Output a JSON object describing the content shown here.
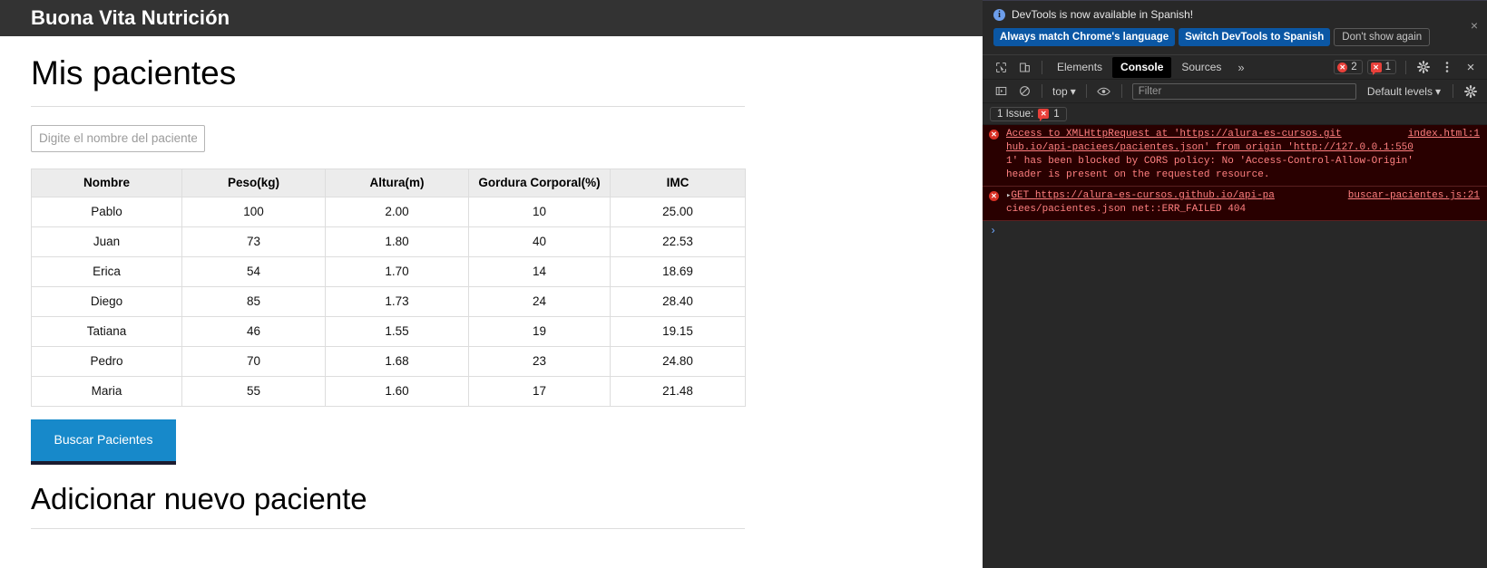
{
  "page": {
    "app_title": "Buona Vita Nutrición",
    "heading_patients": "Mis pacientes",
    "search": {
      "placeholder": "Digite el nombre del paciente",
      "value": ""
    },
    "table": {
      "headers": [
        "Nombre",
        "Peso(kg)",
        "Altura(m)",
        "Gordura Corporal(%)",
        "IMC"
      ],
      "rows": [
        [
          "Pablo",
          "100",
          "2.00",
          "10",
          "25.00"
        ],
        [
          "Juan",
          "73",
          "1.80",
          "40",
          "22.53"
        ],
        [
          "Erica",
          "54",
          "1.70",
          "14",
          "18.69"
        ],
        [
          "Diego",
          "85",
          "1.73",
          "24",
          "28.40"
        ],
        [
          "Tatiana",
          "46",
          "1.55",
          "19",
          "19.15"
        ],
        [
          "Pedro",
          "70",
          "1.68",
          "23",
          "24.80"
        ],
        [
          "Maria",
          "55",
          "1.60",
          "17",
          "21.48"
        ]
      ]
    },
    "search_button": "Buscar Pacientes",
    "heading_add": "Adicionar nuevo paciente",
    "colors": {
      "header_bg": "#333333",
      "button_blue": "#1789ca",
      "button_border": "#1b1b2f"
    }
  },
  "devtools": {
    "notification": {
      "icon": "info-icon",
      "message": "DevTools is now available in Spanish!",
      "primary_button": "Always match Chrome's language",
      "secondary_button": "Switch DevTools to Spanish",
      "dismiss_button": "Don't show again",
      "close_glyph": "×"
    },
    "toolbar": {
      "inspect_icon": "inspect-element-icon",
      "device_icon": "device-toolbar-icon",
      "tabs": [
        {
          "label": "Elements",
          "active": false
        },
        {
          "label": "Console",
          "active": true
        },
        {
          "label": "Sources",
          "active": false
        }
      ],
      "more_tabs_glyph": "»",
      "error_count": "2",
      "warning_count": "1",
      "settings_icon": "gear-icon",
      "kebab_icon": "more-options-icon",
      "close_icon": "close-icon",
      "close_glyph": "×"
    },
    "subtoolbar": {
      "sidebar_icon": "console-sidebar-icon",
      "clear_icon": "clear-console-icon",
      "context": "top",
      "context_caret": "▾",
      "eye_icon": "live-expression-icon",
      "filter_placeholder": "Filter",
      "filter_value": "",
      "levels_label": "Default levels",
      "levels_caret": "▾",
      "settings_icon": "console-settings-icon"
    },
    "issue_bar": {
      "label": "1 Issue:",
      "count": "1"
    },
    "console": {
      "messages": [
        {
          "level": "error",
          "lines": [
            "Access to XMLHttpRequest at 'https://alura-es-cursos.git",
            "hub.io/api-paciees/pacientes.json' from origin 'http://127.0.0.1:550",
            "1' has been blocked by CORS policy: No 'Access-Control-Allow-Origin'",
            "header is present on the requested resource."
          ],
          "source": "index.html:1",
          "expandable": false
        },
        {
          "level": "error",
          "lines": [
            "GET https://alura-es-cursos.github.io/api-pa",
            "ciees/pacientes.json net::ERR_FAILED 404"
          ],
          "source": "buscar-pacientes.js:21",
          "expandable": true,
          "expand_glyph": "▸"
        }
      ],
      "prompt_glyph": "›"
    }
  }
}
